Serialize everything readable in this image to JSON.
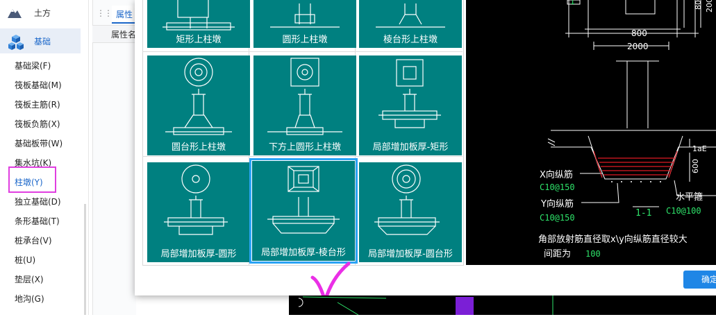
{
  "sidebar": {
    "categories": [
      {
        "label": "土方",
        "icon": "mountain-icon"
      },
      {
        "label": "基础",
        "icon": "cubes-icon"
      }
    ],
    "items": [
      "基础梁(F)",
      "筏板基础(M)",
      "筏板主筋(R)",
      "筏板负筋(X)",
      "基础板带(W)",
      "集水坑(K)",
      "柱墩(Y)",
      "独立基础(D)",
      "条形基础(T)",
      "桩承台(V)",
      "桩(U)",
      "垫层(X)",
      "地沟(G)"
    ],
    "selected_item": "柱墩(Y)"
  },
  "property_panel": {
    "tab_label": "属性",
    "column_header": "属性名"
  },
  "dialog": {
    "grid": [
      {
        "caption": "矩形上柱墩",
        "icon": "rect-upper-pier-icon"
      },
      {
        "caption": "圆形上柱墩",
        "icon": "round-upper-pier-icon"
      },
      {
        "caption": "棱台形上柱墩",
        "icon": "frustum-upper-pier-icon"
      },
      {
        "caption": "圆台形上柱墩",
        "icon": "truncated-cone-upper-pier-icon"
      },
      {
        "caption": "下方上圆形上柱墩",
        "icon": "square-round-upper-pier-icon"
      },
      {
        "caption": "局部增加板厚-矩形",
        "icon": "local-thicken-rect-icon"
      },
      {
        "caption": "局部增加板厚-圆形",
        "icon": "local-thicken-round-icon"
      },
      {
        "caption": "局部增加板厚-棱台形",
        "icon": "local-thicken-frustum-icon"
      },
      {
        "caption": "局部增加板厚-圆台形",
        "icon": "local-thicken-cone-icon"
      }
    ],
    "selected_index": 7,
    "ok_label": "确定"
  },
  "preview": {
    "dims": [
      "800",
      "2000",
      "800",
      "200"
    ],
    "section_label": "1-1",
    "top_label": "1",
    "lae_label": "1aE",
    "dim_600": "600",
    "x_rebar_label": "X向纵筋",
    "x_rebar_value": "C10@150",
    "y_rebar_label": "Y向纵筋",
    "y_rebar_value": "C10@150",
    "horiz_label": "水平箍",
    "horiz_value": "C10@100",
    "note_line1": "角部放射筋直径取x\\y向纵筋直径较大",
    "note_line2_prefix": "间距为",
    "note_line2_value": "100"
  }
}
